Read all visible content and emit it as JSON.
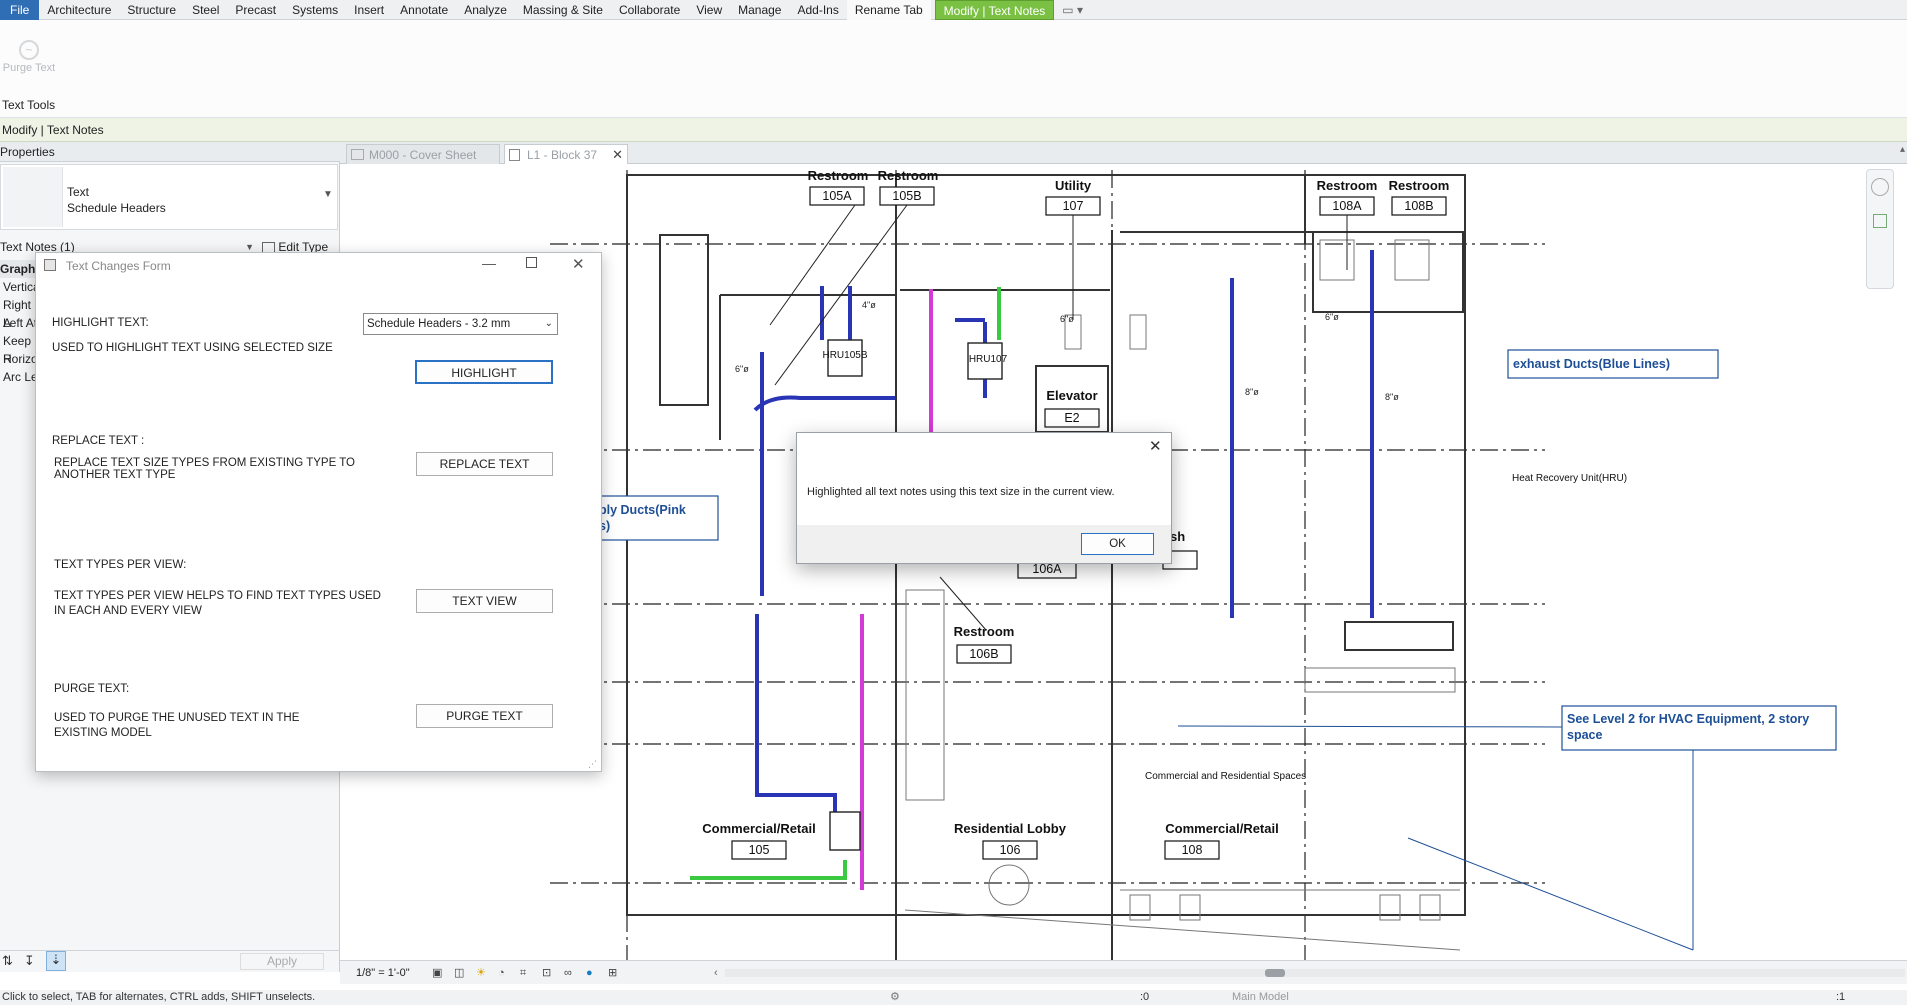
{
  "menu": {
    "items": [
      "File",
      "Architecture",
      "Structure",
      "Steel",
      "Precast",
      "Systems",
      "Insert",
      "Annotate",
      "Analyze",
      "Massing & Site",
      "Collaborate",
      "View",
      "Manage",
      "Add-Ins",
      "Rename Tab",
      "Modify | Text Notes"
    ]
  },
  "ribbon": {
    "purge_label": "Purge Text",
    "panel_label": "Text Tools"
  },
  "context_bar": {
    "label": "Modify | Text Notes"
  },
  "properties": {
    "header": "Properties",
    "type_family": "Text",
    "type_name": "Schedule Headers",
    "instance_filter": "Text Notes (1)",
    "edit_type": "Edit Type",
    "rows": [
      "Graphi",
      "Vertica",
      "Right A",
      "Left At",
      "Keep R",
      "Horizo",
      "Arc Le"
    ],
    "apply": "Apply"
  },
  "view_tabs": [
    {
      "label": "M000 - Cover Sheet"
    },
    {
      "label": "L1 - Block 37"
    }
  ],
  "form": {
    "title": "Text Changes Form",
    "highlight_heading": "HIGHLIGHT TEXT:",
    "highlight_desc": "USED TO  HIGHLIGHT TEXT USING SELECTED SIZE",
    "size_selected": "Schedule Headers - 3.2 mm",
    "highlight_button": "HIGHLIGHT",
    "replace_heading": "REPLACE TEXT :",
    "replace_desc_1": "REPLACE TEXT SIZE TYPES FROM EXISTING TYPE TO",
    "replace_desc_2": "ANOTHER TEXT TYPE",
    "replace_button": "REPLACE TEXT",
    "types_heading": "TEXT TYPES PER VIEW:",
    "types_desc_1": "TEXT TYPES PER VIEW HELPS TO FIND TEXT TYPES USED",
    "types_desc_2": "IN EACH AND EVERY VIEW",
    "types_button": "TEXT VIEW",
    "purge_heading": "PURGE TEXT:",
    "purge_desc_1": "USED TO PURGE THE UNUSED TEXT IN THE",
    "purge_desc_2": "EXISTING MODEL",
    "purge_button": "PURGE TEXT"
  },
  "message": {
    "text": "Highlighted all text notes using this text size in the current view.",
    "ok": "OK"
  },
  "drawing": {
    "rooms": [
      {
        "name": "Restroom",
        "num": "105A"
      },
      {
        "name": "Restroom",
        "num": "105B"
      },
      {
        "name": "Utility",
        "num": "107"
      },
      {
        "name": "Restroom",
        "num": "108A"
      },
      {
        "name": "Restroom",
        "num": "108B"
      },
      {
        "name": "Elevator",
        "num": "E2"
      },
      {
        "name": "Restroom",
        "num": "106B"
      },
      {
        "name": "Commercial/Retail",
        "num": "105"
      },
      {
        "name": "Residential Lobby",
        "num": "106"
      },
      {
        "name": "Commercial/Retail",
        "num": "108"
      }
    ],
    "room_106a": "106A",
    "room_partial": "sh",
    "hru_1": "HRU105B",
    "hru_2": "HRU107",
    "note_exhaust": "exhaust Ducts(Blue Lines)",
    "note_hru": "Heat Recovery Unit(HRU)",
    "note_supply_1": "ply Ducts(Pink",
    "note_supply_2": "s)",
    "note_level2_1": "See Level 2 for HVAC Equipment, 2 story",
    "note_level2_2": "space",
    "note_commercial": "Commercial and Residential Spaces",
    "dim_1": "6\"ø",
    "dim_2": "8\"ø",
    "dim_3": "4\"ø"
  },
  "view_control": {
    "scale": "1/8\" = 1'-0\""
  },
  "status": {
    "hint": "Click to select, TAB for alternates, CTRL adds, SHIFT unselects.",
    "model": "Main Model",
    "count": ":0",
    "filter": ":1"
  }
}
